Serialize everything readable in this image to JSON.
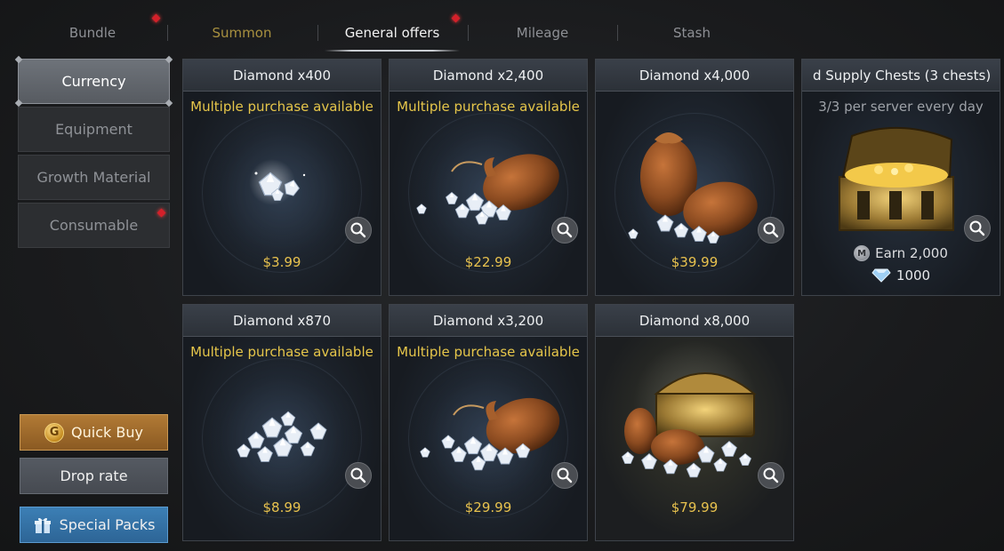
{
  "tabs": [
    {
      "label": "Bundle",
      "has_alert": true
    },
    {
      "label": "Summon",
      "has_alert": false
    },
    {
      "label": "General offers",
      "has_alert": true,
      "active": true
    },
    {
      "label": "Mileage",
      "has_alert": false
    },
    {
      "label": "Stash",
      "has_alert": false
    }
  ],
  "categories": [
    {
      "label": "Currency",
      "active": true
    },
    {
      "label": "Equipment"
    },
    {
      "label": "Growth Material"
    },
    {
      "label": "Consumable",
      "has_alert": true
    }
  ],
  "side_buttons": {
    "quick_buy": "Quick Buy",
    "quick_buy_coin": "G",
    "drop_rate": "Drop rate",
    "special_packs": "Special Packs"
  },
  "products": [
    {
      "title": "Diamond x400",
      "subtitle": "Multiple purchase available",
      "price": "$3.99",
      "art": "small-diamonds"
    },
    {
      "title": "Diamond x2,400",
      "subtitle": "Multiple purchase available",
      "price": "$22.99",
      "art": "diamond-pouch"
    },
    {
      "title": "Diamond x4,000",
      "subtitle": "",
      "price": "$39.99",
      "art": "two-pouches"
    },
    {
      "title": "d Supply Chests (3 chests)",
      "subtitle": "3/3 per server every day",
      "earn": "Earn 2,000",
      "earn_coin": "M",
      "cost": "1000",
      "art": "treasure-chest"
    },
    {
      "title": "Diamond x870",
      "subtitle": "Multiple purchase available",
      "price": "$8.99",
      "art": "diamond-pile"
    },
    {
      "title": "Diamond x3,200",
      "subtitle": "Multiple purchase available",
      "price": "$29.99",
      "art": "diamond-pouch"
    },
    {
      "title": "Diamond x8,000",
      "subtitle": "",
      "price": "$79.99",
      "art": "chest-and-pouches"
    }
  ],
  "colors": {
    "gold_text": "#e6c64a",
    "price": "#e8c24e",
    "alert": "#d3202a",
    "quick_buy_bg": "#a06c2c",
    "special_packs_bg": "#3573a6"
  }
}
